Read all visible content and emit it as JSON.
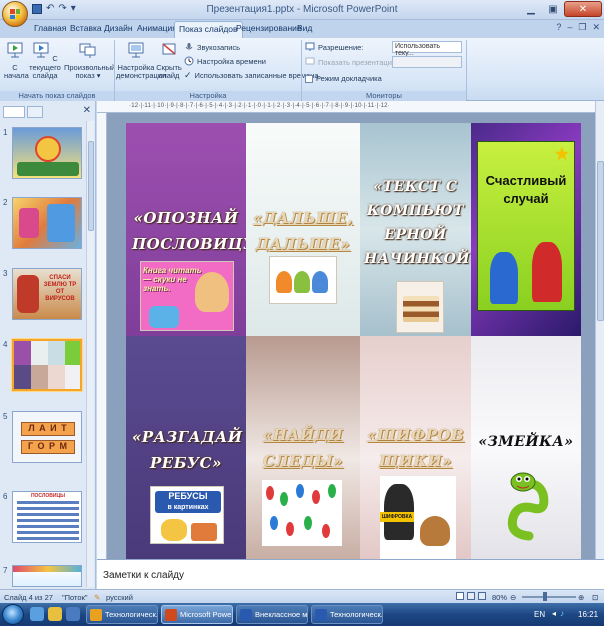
{
  "window": {
    "title": "Презентация1.pptx - Microsoft PowerPoint"
  },
  "qat": {
    "undo": "↶",
    "redo": "↷",
    "customize": "▾"
  },
  "tabs": [
    "Главная",
    "Вставка",
    "Дизайн",
    "Анимация",
    "Показ слайдов",
    "Рецензирование",
    "Вид"
  ],
  "active_tab": "Показ слайдов",
  "ribbon": {
    "start_group": {
      "label": "Начать показ слайдов",
      "btn_from_start": "С начала",
      "btn_from_current": "С текущего слайда",
      "btn_custom": "Произвольный показ ▾"
    },
    "setup_group": {
      "label": "Настройка",
      "btn_setup": "Настройка демонстрации",
      "btn_hide": "Скрыть слайд",
      "record_narration": "Звукозапись",
      "rehearse_timings": "Настройка времени",
      "use_timings": "Использовать записанные времена"
    },
    "monitors_group": {
      "label": "Мониторы",
      "resolution_label": "Разрешение:",
      "resolution_value": "Использовать теку...",
      "show_on_label": "Показать презентацию на:",
      "presenter_view": "Режим докладчика"
    }
  },
  "ruler_marks": "·12·|·11·|·10·|·9·|·8·|·7·|·6·|·5·|·4·|·3·|·2·|·1·|·0·|·1·|·2·|·3·|·4·|·5·|·6·|·7·|·8·|·9·|·10·|·11·|·12·",
  "thumbnails": {
    "numbers": [
      "1",
      "2",
      "3",
      "4",
      "5",
      "6",
      "7"
    ],
    "slide3_text": "СПАСИ ЗЕМЛЮ ТР ОТ ВИРУСОВ",
    "slide5_top": "Л А И Т",
    "slide5_bottom": "Г О Р М",
    "slide6_title": "ПОСЛОВИЦЫ"
  },
  "slide": {
    "cells": {
      "c1": "«ОПОЗНАЙ ПОСЛОВИЦУ»",
      "c1_pic": "Книга читать — скуки не знать.",
      "c2": "«ДАЛЬШЕ, ДАЛЬШЕ»",
      "c3": "«ТЕКСТ С КОМПЬЮТ ЕРНОЙ НАЧИНКОЙ»",
      "c4_pic": "Счастливый случай",
      "c5": "«РАЗГАДАЙ РЕБУС»",
      "c5_pic_title": "РЕБУСЫ",
      "c5_pic_sub": "в картинках",
      "c6": "«НАЙДИ СЛЕДЫ»",
      "c7": "«ШИФРОВ ЩИКИ»",
      "c7_badge": "ШИФРОВКА",
      "c8": "«ЗМЕЙКА»"
    }
  },
  "notes": "Заметки к слайду",
  "status": {
    "slide_counter": "Слайд 4 из 27",
    "theme": "\"Поток\"",
    "language": "русский",
    "zoom": "80%"
  },
  "taskbar": {
    "tasks": [
      "Технологическ...",
      "Microsoft Powe...",
      "Внеклассное м...",
      "Технологическ..."
    ],
    "lang": "EN",
    "clock": "16:21"
  },
  "colors": {
    "ribbon_bg": "#dce8f7",
    "accent_selected": "#f3a62a"
  }
}
